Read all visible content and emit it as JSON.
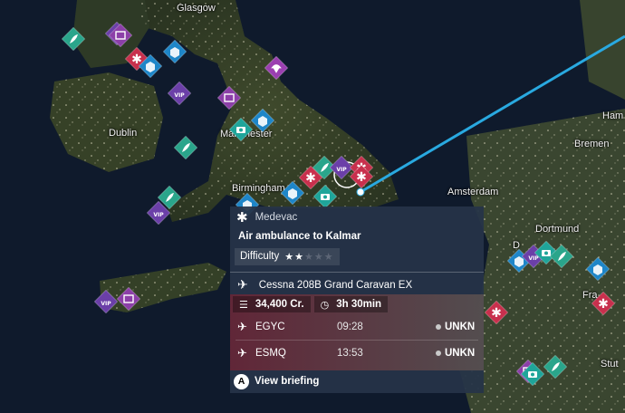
{
  "map": {
    "cities": [
      {
        "id": "glasgow",
        "label": "Glasgow"
      },
      {
        "id": "dublin",
        "label": "Dublin"
      },
      {
        "id": "manchester",
        "label": "Manchester"
      },
      {
        "id": "birmingham",
        "label": "Birmingham"
      },
      {
        "id": "amsterdam",
        "label": "Amsterdam"
      },
      {
        "id": "bremen",
        "label": "Bremen"
      },
      {
        "id": "hamburg",
        "label": "Ham"
      },
      {
        "id": "dortmund",
        "label": "Dortmund"
      },
      {
        "id": "frankfurt",
        "label": "Fra"
      },
      {
        "id": "stuttgart",
        "label": "Stut"
      },
      {
        "id": "dusseldorf",
        "label": "D"
      }
    ],
    "colors": {
      "route": "#29a9e0",
      "medevac": "#c8304d",
      "cargo": "#1e86c8",
      "vip": "#6b3fa8",
      "passenger": "#8c3fa8",
      "photo": "#1fa59a",
      "delivery": "#2aa58b",
      "skydive": "#9b3fb0"
    }
  },
  "popup": {
    "category": "Medevac",
    "category_icon": "asterisk-icon",
    "title": "Air ambulance to Kalmar",
    "difficulty_label": "Difficulty",
    "difficulty_stars": 2,
    "difficulty_max": 5,
    "aircraft": "Cessna 208B Grand Caravan EX",
    "reward": "34,400 Cr.",
    "duration": "3h 30min",
    "departure": {
      "code": "EGYC",
      "time": "09:28",
      "status": "UNKN"
    },
    "arrival": {
      "code": "ESMQ",
      "time": "13:53",
      "status": "UNKN"
    },
    "briefing_button": "A",
    "briefing_label": "View briefing"
  }
}
